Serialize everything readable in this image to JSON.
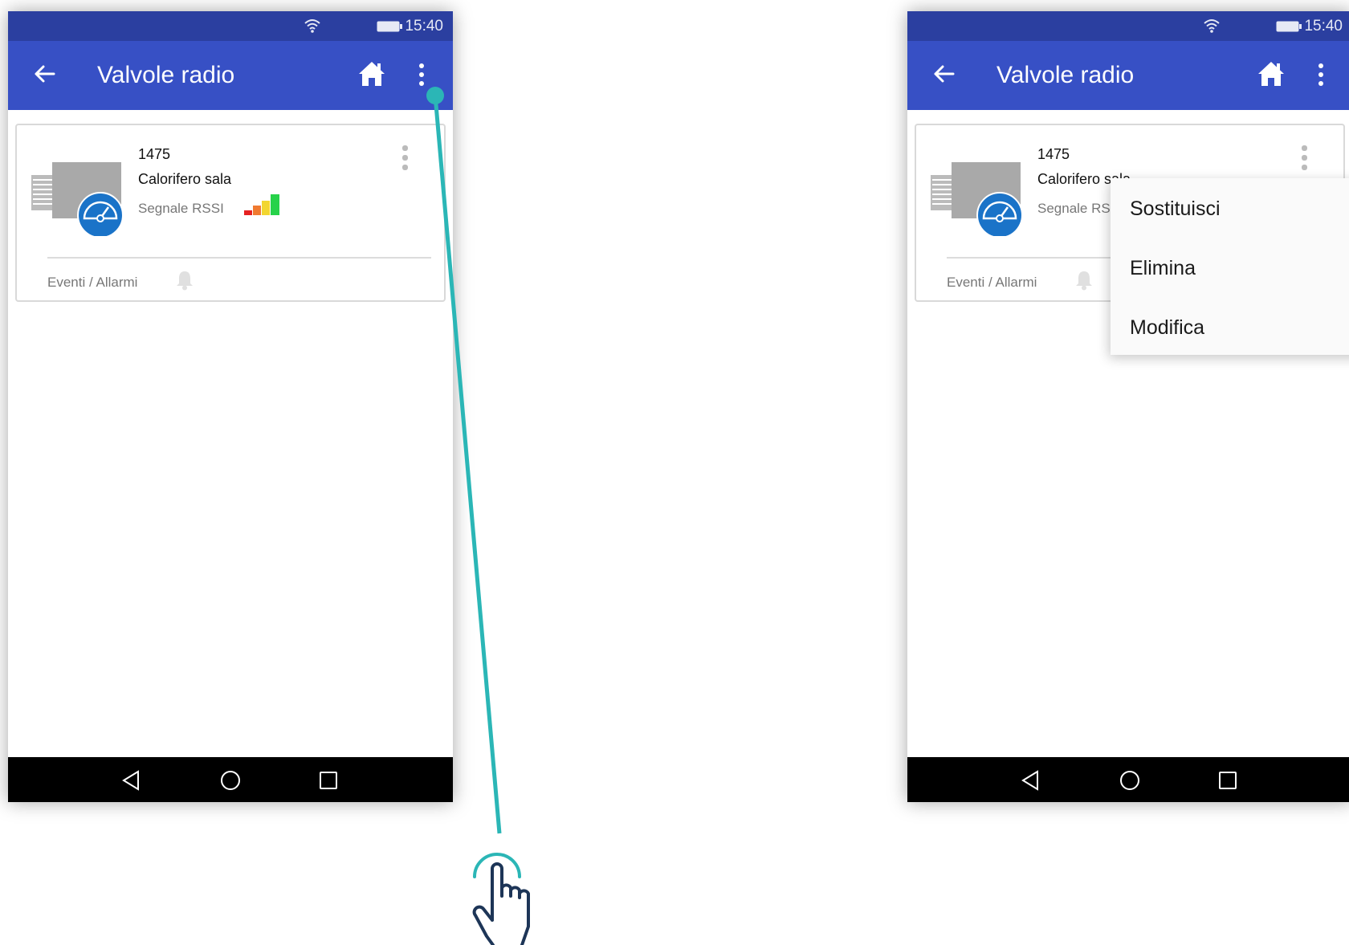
{
  "status_bar": {
    "time": "15:40"
  },
  "app_bar": {
    "title": "Valvole radio"
  },
  "device_card": {
    "id": "1475",
    "name": "Calorifero sala",
    "signal_label": "Segnale RSSI",
    "events_label": "Eventi / Allarmi"
  },
  "context_menu": {
    "items": [
      "Sostituisci",
      "Elimina",
      "Modifica"
    ]
  },
  "colors": {
    "status_bar": "#2b3fa0",
    "app_bar": "#3750c5",
    "valve_badge": "#1a73c8",
    "connector": "#2bb6b6",
    "hand": "#1d3557"
  },
  "icons": [
    "wifi-icon",
    "battery-icon",
    "back-arrow-icon",
    "home-icon",
    "overflow-menu-icon",
    "bell-icon",
    "nav-back-icon",
    "nav-home-icon",
    "nav-recents-icon",
    "tap-hand-icon"
  ]
}
